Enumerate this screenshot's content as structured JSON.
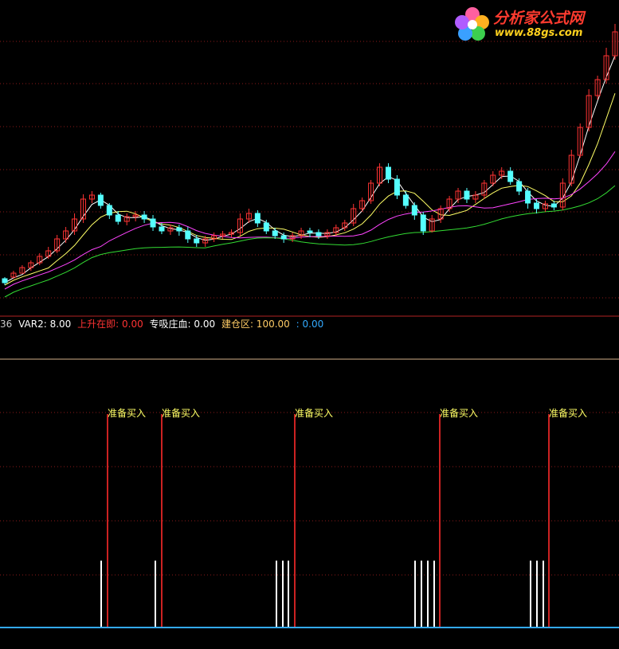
{
  "logo": {
    "title": "分析家公式网",
    "url": "www.88gs.com"
  },
  "legend": {
    "item0": "36",
    "item1": "VAR2: 8.00",
    "item2": "上升在即: 0.00",
    "item3": "专吸庄血: 0.00",
    "item4": "建仓区: 100.00",
    "item5": ": 0.00"
  },
  "colors": {
    "bg": "#000000",
    "up_candle": "#ff3333",
    "down_candle": "#55ffff",
    "ma_short": "#ffffff",
    "ma_mid": "#ffff66",
    "ma_long": "#ff44ff",
    "ma_slow": "#33dd33",
    "grid": "#8b1a1a",
    "panel_divider": "#b22222",
    "signal": "#cc2222",
    "signal_label": "#ffff66",
    "white_bar": "#ffffff",
    "baseline": "#33aaff"
  },
  "chart_data": {
    "type": "candlestick",
    "upper_panel": {
      "candles_approx": [
        [
          350,
          355,
          348,
          358
        ],
        [
          348,
          343,
          340,
          350
        ],
        [
          343,
          336,
          333,
          342
        ],
        [
          336,
          330,
          327,
          340
        ],
        [
          330,
          322,
          318,
          333
        ],
        [
          322,
          315,
          310,
          325
        ],
        [
          315,
          300,
          295,
          318
        ],
        [
          300,
          290,
          285,
          305
        ],
        [
          290,
          275,
          268,
          295
        ],
        [
          275,
          250,
          244,
          280
        ],
        [
          250,
          245,
          240,
          255
        ],
        [
          245,
          258,
          242,
          262
        ],
        [
          258,
          270,
          255,
          275
        ],
        [
          270,
          278,
          265,
          282
        ],
        [
          278,
          272,
          268,
          283
        ],
        [
          272,
          270,
          265,
          278
        ],
        [
          270,
          275,
          265,
          280
        ],
        [
          275,
          285,
          270,
          290
        ],
        [
          285,
          290,
          280,
          294
        ],
        [
          290,
          286,
          282,
          295
        ],
        [
          286,
          290,
          282,
          296
        ],
        [
          290,
          300,
          285,
          305
        ],
        [
          300,
          305,
          295,
          310
        ],
        [
          305,
          300,
          296,
          310
        ],
        [
          300,
          296,
          292,
          304
        ],
        [
          296,
          294,
          290,
          300
        ],
        [
          294,
          292,
          288,
          298
        ],
        [
          292,
          275,
          268,
          296
        ],
        [
          275,
          268,
          262,
          280
        ],
        [
          268,
          280,
          264,
          285
        ],
        [
          280,
          290,
          276,
          294
        ],
        [
          290,
          296,
          286,
          300
        ],
        [
          296,
          300,
          292,
          305
        ],
        [
          300,
          296,
          292,
          304
        ],
        [
          296,
          290,
          286,
          300
        ],
        [
          290,
          292,
          286,
          298
        ],
        [
          292,
          296,
          288,
          300
        ],
        [
          296,
          292,
          288,
          300
        ],
        [
          292,
          286,
          282,
          296
        ],
        [
          286,
          280,
          276,
          290
        ],
        [
          280,
          262,
          256,
          284
        ],
        [
          262,
          252,
          248,
          266
        ],
        [
          252,
          230,
          226,
          256
        ],
        [
          230,
          210,
          205,
          234
        ],
        [
          210,
          225,
          205,
          230
        ],
        [
          225,
          245,
          220,
          250
        ],
        [
          245,
          258,
          240,
          262
        ],
        [
          258,
          270,
          254,
          276
        ],
        [
          270,
          290,
          266,
          295
        ],
        [
          290,
          275,
          270,
          292
        ],
        [
          275,
          262,
          258,
          280
        ],
        [
          262,
          250,
          246,
          266
        ],
        [
          250,
          240,
          236,
          255
        ],
        [
          240,
          250,
          236,
          255
        ],
        [
          250,
          245,
          240,
          255
        ],
        [
          245,
          230,
          226,
          250
        ],
        [
          230,
          220,
          215,
          234
        ],
        [
          220,
          215,
          210,
          225
        ],
        [
          215,
          228,
          210,
          232
        ],
        [
          228,
          240,
          224,
          245
        ],
        [
          240,
          255,
          236,
          262
        ],
        [
          255,
          262,
          250,
          268
        ],
        [
          262,
          256,
          252,
          266
        ],
        [
          256,
          260,
          252,
          264
        ],
        [
          260,
          230,
          224,
          264
        ],
        [
          230,
          195,
          188,
          234
        ],
        [
          195,
          160,
          155,
          198
        ],
        [
          160,
          120,
          112,
          165
        ],
        [
          120,
          100,
          95,
          125
        ],
        [
          100,
          70,
          60,
          105
        ],
        [
          70,
          40,
          30,
          75
        ]
      ],
      "moving_averages": [
        "MA-short",
        "MA-mid",
        "MA-long",
        "MA-slow"
      ]
    },
    "lower_panel": {
      "signal_label": "准备买入",
      "signal_count": 5,
      "white_bar_groups": [
        1,
        1,
        3,
        4,
        3
      ]
    }
  }
}
